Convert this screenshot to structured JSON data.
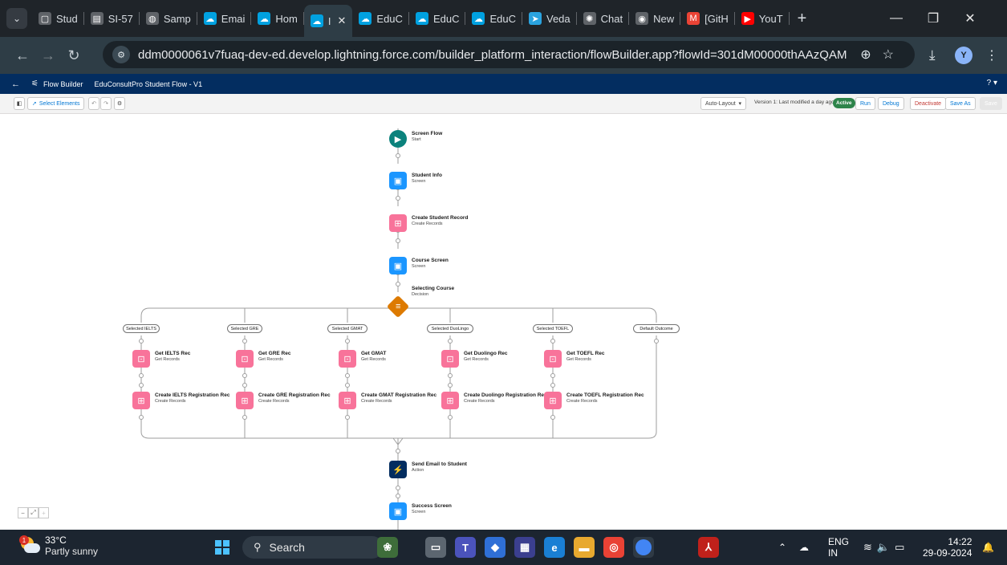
{
  "browser": {
    "tabs": [
      {
        "label": "Stud",
        "icon": "page-icon",
        "color": "#5f6368",
        "glyph": "▢"
      },
      {
        "label": "SI-57",
        "icon": "doc-icon",
        "color": "#5f6368",
        "glyph": "▤"
      },
      {
        "label": "Samp",
        "icon": "globe-icon",
        "color": "#5f6368",
        "glyph": "◍"
      },
      {
        "label": "Emai",
        "icon": "salesforce-cloud-icon",
        "color": "#00a1e0",
        "glyph": "☁"
      },
      {
        "label": "Hom",
        "icon": "salesforce-cloud-icon",
        "color": "#00a1e0",
        "glyph": "☁"
      },
      {
        "label": "I",
        "icon": "salesforce-cloud-icon",
        "color": "#00a1e0",
        "glyph": "☁",
        "active": true
      },
      {
        "label": "EduC",
        "icon": "salesforce-cloud-icon",
        "color": "#00a1e0",
        "glyph": "☁"
      },
      {
        "label": "EduC",
        "icon": "salesforce-cloud-icon",
        "color": "#00a1e0",
        "glyph": "☁"
      },
      {
        "label": "EduC",
        "icon": "salesforce-cloud-icon",
        "color": "#00a1e0",
        "glyph": "☁"
      },
      {
        "label": "Veda",
        "icon": "telegram-icon",
        "color": "#2aa3df",
        "glyph": "➤"
      },
      {
        "label": "Chat",
        "icon": "openai-icon",
        "color": "#5f6368",
        "glyph": "✺"
      },
      {
        "label": "New",
        "icon": "github-icon",
        "color": "#5f6368",
        "glyph": "◉"
      },
      {
        "label": "[GitH",
        "icon": "gmail-icon",
        "color": "#ea4335",
        "glyph": "M"
      },
      {
        "label": "YouT",
        "icon": "youtube-icon",
        "color": "#ff0000",
        "glyph": "▶"
      }
    ],
    "url": "ddm0000061v7fuaq-dev-ed.develop.lightning.force.com/builder_platform_interaction/flowBuilder.app?flowId=301dM00000thAAzQAM",
    "profile_initial": "Y"
  },
  "sf_header": {
    "app": "Flow Builder",
    "flow_name": "EduConsultPro Student Flow - V1",
    "help": "? ▾"
  },
  "toolbar": {
    "select_elements": "Select Elements",
    "layout": "Auto-Layout",
    "version_text": "Version 1: Last modified a day ago",
    "status": "Active",
    "run": "Run",
    "debug": "Debug",
    "deactivate": "Deactivate",
    "save_as": "Save As",
    "save": "Save"
  },
  "flow": {
    "start": {
      "title": "Screen Flow",
      "subtitle": "Start"
    },
    "student_info": {
      "title": "Student Info",
      "subtitle": "Screen"
    },
    "create_student": {
      "title": "Create Student Record",
      "subtitle": "Create Records"
    },
    "course_screen": {
      "title": "Course Screen",
      "subtitle": "Screen"
    },
    "decision": {
      "title": "Selecting Course",
      "subtitle": "Decision"
    },
    "outcomes": [
      "Selected IELTS",
      "Selected GRE",
      "Selected GMAT",
      "Selected DuoLingo",
      "Selected TOEFL",
      "Default Outcome"
    ],
    "get_nodes": [
      {
        "title": "Get IELTS Rec",
        "subtitle": "Get Records"
      },
      {
        "title": "Get GRE Rec",
        "subtitle": "Get Records"
      },
      {
        "title": "Get GMAT",
        "subtitle": "Get Records"
      },
      {
        "title": "Get Duolingo Rec",
        "subtitle": "Get Records"
      },
      {
        "title": "Get TOEFL Rec",
        "subtitle": "Get Records"
      }
    ],
    "create_nodes": [
      {
        "title": "Create IELTS Registration Rec",
        "subtitle": "Create Records"
      },
      {
        "title": "Create GRE Registration Rec",
        "subtitle": "Create Records"
      },
      {
        "title": "Create GMAT Registration Rec",
        "subtitle": "Create Records"
      },
      {
        "title": "Create Duolingo Registration Rec",
        "subtitle": "Create Records"
      },
      {
        "title": "Create TOEFL Registration Rec",
        "subtitle": "Create Records"
      }
    ],
    "send_email": {
      "title": "Send Email to Student",
      "subtitle": "Action"
    },
    "success": {
      "title": "Success Screen",
      "subtitle": "Screen"
    }
  },
  "taskbar": {
    "weather_temp": "33°C",
    "weather_cond": "Partly sunny",
    "notif_count": "1",
    "search": "Search",
    "lang_top": "ENG",
    "lang_bottom": "IN",
    "time": "14:22",
    "date": "29-09-2024"
  },
  "colors": {
    "sf_navy": "#032d60",
    "screen_blue": "#1b96ff",
    "records_pink": "#f8739a",
    "start_teal": "#0b827c",
    "decision_orange": "#dd7a01",
    "active_green": "#2e844a"
  }
}
